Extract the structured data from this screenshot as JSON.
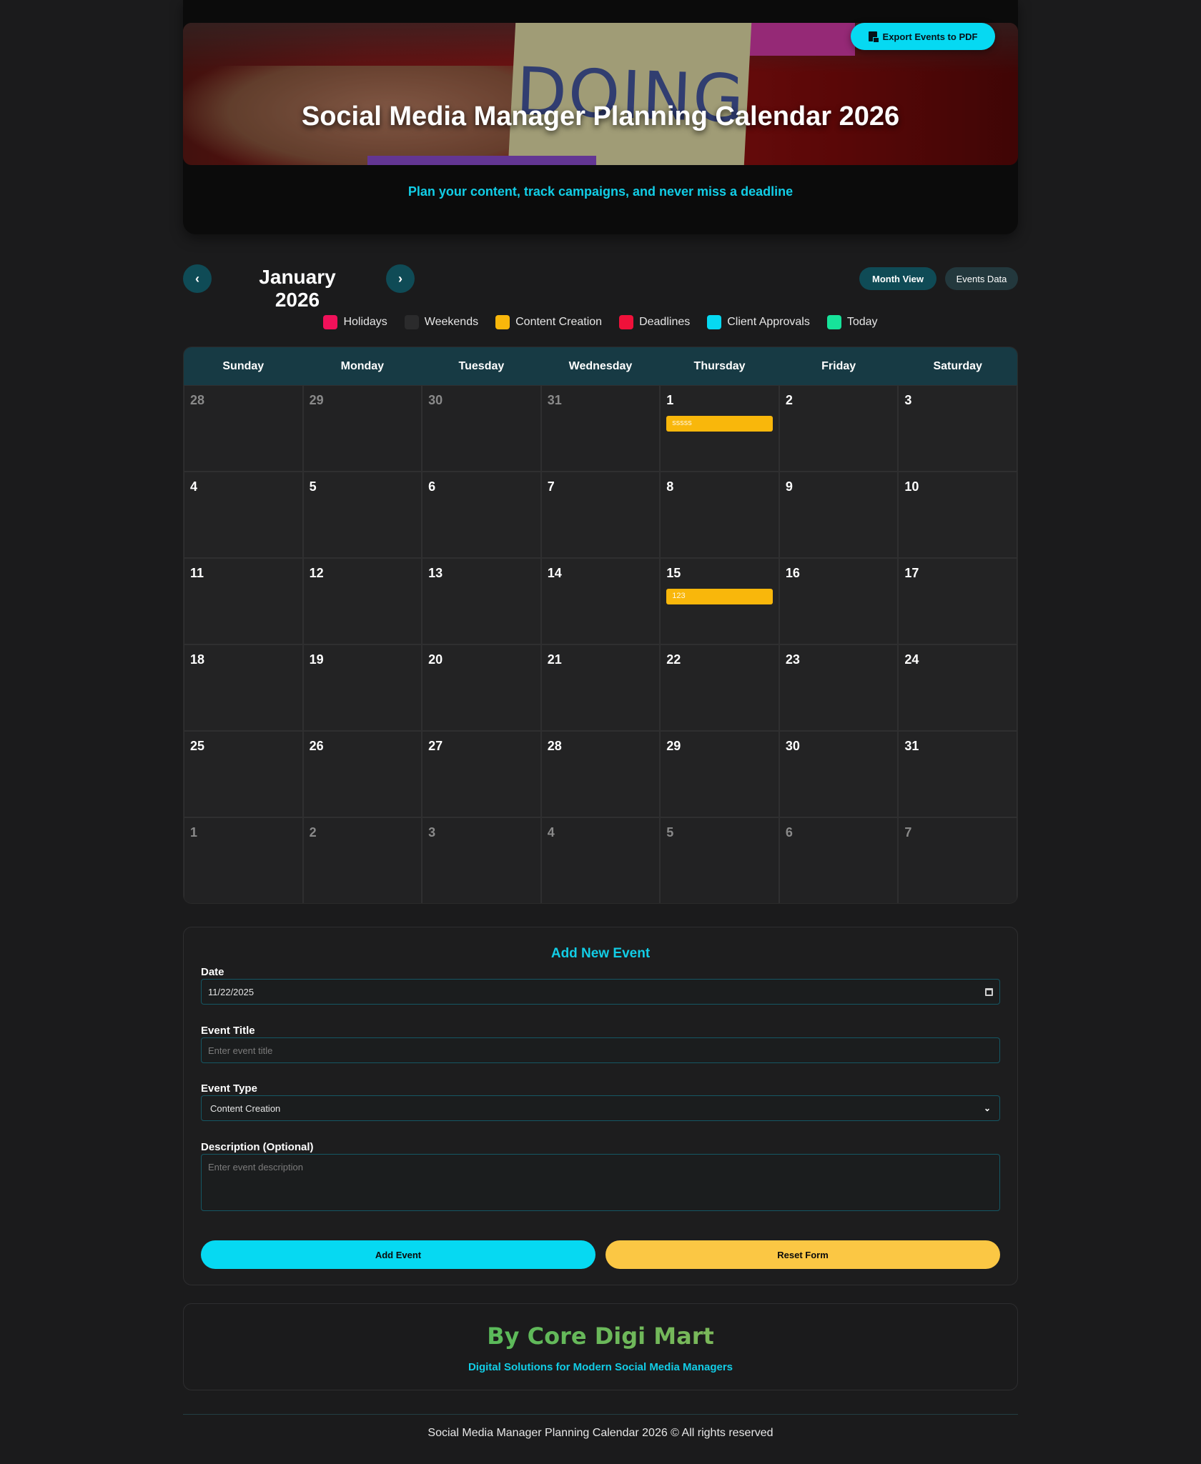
{
  "header": {
    "title": "Social Media Manager Planning Calendar 2026",
    "subtitle": "Plan your content, track campaigns, and never miss a deadline",
    "export_label": "Export Events to PDF",
    "banner_word": "DOING"
  },
  "nav": {
    "month_label": "January 2026",
    "prev_icon": "‹",
    "next_icon": "›",
    "views": [
      {
        "label": "Month View",
        "active": true
      },
      {
        "label": "Events Data",
        "active": false
      }
    ]
  },
  "legend": [
    {
      "label": "Holidays",
      "color": "#f0115a"
    },
    {
      "label": "Weekends",
      "color": "#2b2b2c"
    },
    {
      "label": "Content Creation",
      "color": "#f9b70b"
    },
    {
      "label": "Deadlines",
      "color": "#f0113a"
    },
    {
      "label": "Client Approvals",
      "color": "#06d9f2"
    },
    {
      "label": "Today",
      "color": "#16e39a"
    }
  ],
  "calendar": {
    "weekdays": [
      "Sunday",
      "Monday",
      "Tuesday",
      "Wednesday",
      "Thursday",
      "Friday",
      "Saturday"
    ],
    "days": [
      {
        "n": "28",
        "other": true
      },
      {
        "n": "29",
        "other": true
      },
      {
        "n": "30",
        "other": true
      },
      {
        "n": "31",
        "other": true
      },
      {
        "n": "1",
        "event": "sssss"
      },
      {
        "n": "2"
      },
      {
        "n": "3"
      },
      {
        "n": "4"
      },
      {
        "n": "5"
      },
      {
        "n": "6"
      },
      {
        "n": "7"
      },
      {
        "n": "8"
      },
      {
        "n": "9"
      },
      {
        "n": "10"
      },
      {
        "n": "11"
      },
      {
        "n": "12"
      },
      {
        "n": "13"
      },
      {
        "n": "14"
      },
      {
        "n": "15",
        "event": "123"
      },
      {
        "n": "16"
      },
      {
        "n": "17"
      },
      {
        "n": "18"
      },
      {
        "n": "19"
      },
      {
        "n": "20"
      },
      {
        "n": "21"
      },
      {
        "n": "22"
      },
      {
        "n": "23"
      },
      {
        "n": "24"
      },
      {
        "n": "25"
      },
      {
        "n": "26"
      },
      {
        "n": "27"
      },
      {
        "n": "28"
      },
      {
        "n": "29"
      },
      {
        "n": "30"
      },
      {
        "n": "31"
      },
      {
        "n": "1",
        "other": true
      },
      {
        "n": "2",
        "other": true
      },
      {
        "n": "3",
        "other": true
      },
      {
        "n": "4",
        "other": true
      },
      {
        "n": "5",
        "other": true
      },
      {
        "n": "6",
        "other": true
      },
      {
        "n": "7",
        "other": true
      }
    ]
  },
  "form": {
    "title": "Add New Event",
    "date_label": "Date",
    "date_value": "11/22/2025",
    "title_label": "Event Title",
    "title_placeholder": "Enter event title",
    "type_label": "Event Type",
    "type_value": "Content Creation",
    "desc_label": "Description (Optional)",
    "desc_placeholder": "Enter event description",
    "add_label": "Add Event",
    "reset_label": "Reset Form",
    "add_color": "#06d9f2",
    "reset_color": "#fbc744"
  },
  "brand": {
    "name": "By Core Digi Mart",
    "tagline": "Digital Solutions for Modern Social Media Managers"
  },
  "footer": {
    "text": "Social Media Manager Planning Calendar 2026 © All rights reserved"
  }
}
